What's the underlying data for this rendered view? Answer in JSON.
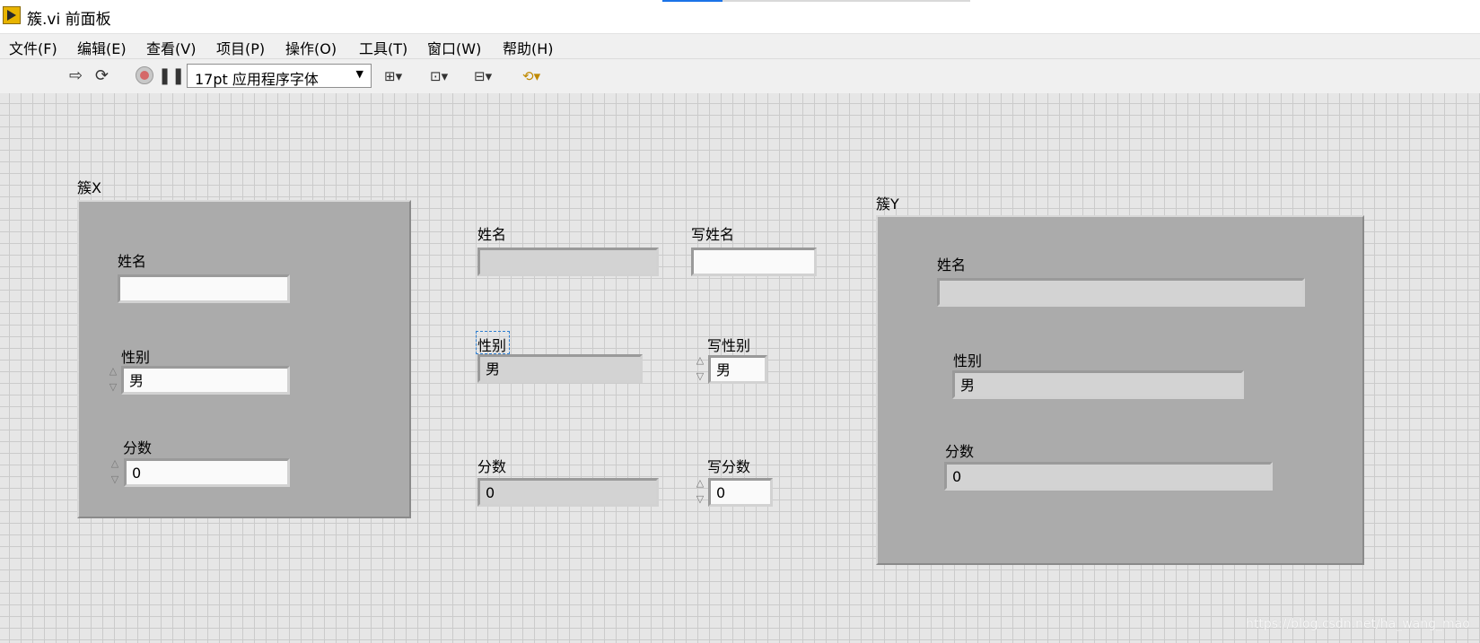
{
  "window": {
    "title": "簇.vi 前面板",
    "icon": "labview-vi-icon"
  },
  "menu": {
    "items": [
      "文件(F)",
      "编辑(E)",
      "查看(V)",
      "项目(P)",
      "操作(O)",
      "工具(T)",
      "窗口(W)",
      "帮助(H)"
    ]
  },
  "toolbar": {
    "font_value": "17pt 应用程序字体",
    "icons": [
      "run-arrow-icon",
      "run-continuously-icon",
      "abort-icon",
      "pause-icon",
      "align-objects-icon",
      "distribute-objects-icon",
      "resize-objects-icon",
      "reorder-icon"
    ]
  },
  "front_panel": {
    "cluster_x": {
      "label": "簇X",
      "name_label": "姓名",
      "name_value": "",
      "gender_label": "性别",
      "gender_value": "男",
      "score_label": "分数",
      "score_value": "0"
    },
    "middle": {
      "name_label": "姓名",
      "name_value": "",
      "gender_label": "性别",
      "gender_value": "男",
      "score_label": "分数",
      "score_value": "0"
    },
    "write": {
      "name_label": "写姓名",
      "name_value": "",
      "gender_label": "写性别",
      "gender_value": "男",
      "score_label": "写分数",
      "score_value": "0"
    },
    "cluster_y": {
      "label": "簇Y",
      "name_label": "姓名",
      "name_value": "",
      "gender_label": "性别",
      "gender_value": "男",
      "score_label": "分数",
      "score_value": "0"
    }
  },
  "watermark": "https://blog.csdn.net/ha_wang_mao",
  "colors": {
    "tab_highlight": "#1a73e8",
    "panel_bg": "#e6e6e6",
    "cluster_bg": "#ababab",
    "control_bg": "#fafafa",
    "indicator_bg": "#d3d3d3"
  }
}
